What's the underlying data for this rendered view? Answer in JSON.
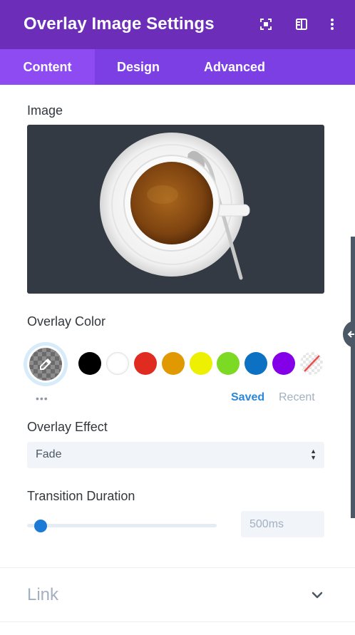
{
  "header": {
    "title": "Overlay Image Settings",
    "bg_color": "#6c2eb9",
    "icons": [
      "expand-icon",
      "sidebar-toggle-icon",
      "more-vertical-icon"
    ]
  },
  "tabs": [
    {
      "label": "Content",
      "active": true
    },
    {
      "label": "Design",
      "active": false
    },
    {
      "label": "Advanced",
      "active": false
    }
  ],
  "image_section": {
    "label": "Image",
    "preview": "coffee-cup-image"
  },
  "overlay_color": {
    "label": "Overlay Color",
    "picker_icon": "eyedropper-icon",
    "swatches": [
      "#000000",
      "#ffffff",
      "#e02b20",
      "#e09900",
      "#edf000",
      "#7cda24",
      "#0c71c3",
      "#8300e9",
      "none"
    ],
    "more_label": "•••",
    "saved_label": "Saved",
    "recent_label": "Recent"
  },
  "overlay_effect": {
    "label": "Overlay Effect",
    "value": "Fade"
  },
  "transition_duration": {
    "label": "Transition Duration",
    "value": "500ms",
    "slider_fraction": 0.05
  },
  "link_section": {
    "label": "Link"
  },
  "accent_color": "#2b87da"
}
